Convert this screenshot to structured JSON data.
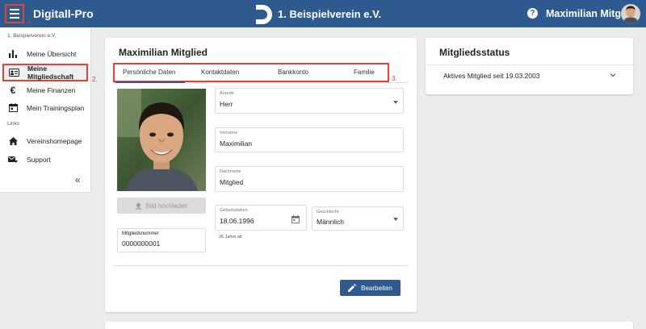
{
  "header": {
    "app_title": "Digitall-Pro",
    "club_name": "1. Beispielverein e.V.",
    "user_name": "Maximilian Mitglied",
    "callout_menu": "1."
  },
  "sidebar": {
    "section_club": "1. Beispielverein e.V.",
    "section_links": "Links",
    "callout_active": "2.",
    "items": [
      {
        "label": "Meine Übersicht",
        "icon": "bar-chart-icon"
      },
      {
        "label": "Meine Mitgliedschaft",
        "icon": "id-card-icon",
        "active": true
      },
      {
        "label": "Meine Finanzen",
        "icon": "euro-icon"
      },
      {
        "label": "Mein Trainingsplan",
        "icon": "calendar-icon"
      }
    ],
    "links": [
      {
        "label": "Vereinshomepage",
        "icon": "home-icon"
      },
      {
        "label": "Support",
        "icon": "support-mail-icon"
      }
    ]
  },
  "profile": {
    "title": "Maximilian Mitglied",
    "tabs_callout": "3.",
    "tabs": [
      {
        "label": "Persönliche Daten",
        "active": true
      },
      {
        "label": "Kontaktdaten"
      },
      {
        "label": "Bankkonto"
      },
      {
        "label": "Familie"
      }
    ],
    "upload_label": "Bild hochladen",
    "member_number_label": "Mitgliedsnummer",
    "member_number": "0000000001",
    "salutation_label": "Anrede",
    "salutation": "Herr",
    "first_name_label": "Vorname",
    "first_name": "Maximilian",
    "last_name_label": "Nachname",
    "last_name": "Mitglied",
    "birthdate_label": "Geburtsdatum",
    "birthdate": "18.06.1996",
    "age_text": "26 Jahre alt",
    "gender_label": "Geschlecht",
    "gender": "Männlich",
    "edit_label": "Bearbeiten"
  },
  "status": {
    "title": "Mitgliedsstatus",
    "text": "Aktives Mitglied seit 19.03.2003"
  },
  "colors": {
    "primary": "#2f5a8f",
    "highlight": "#e6432e"
  }
}
